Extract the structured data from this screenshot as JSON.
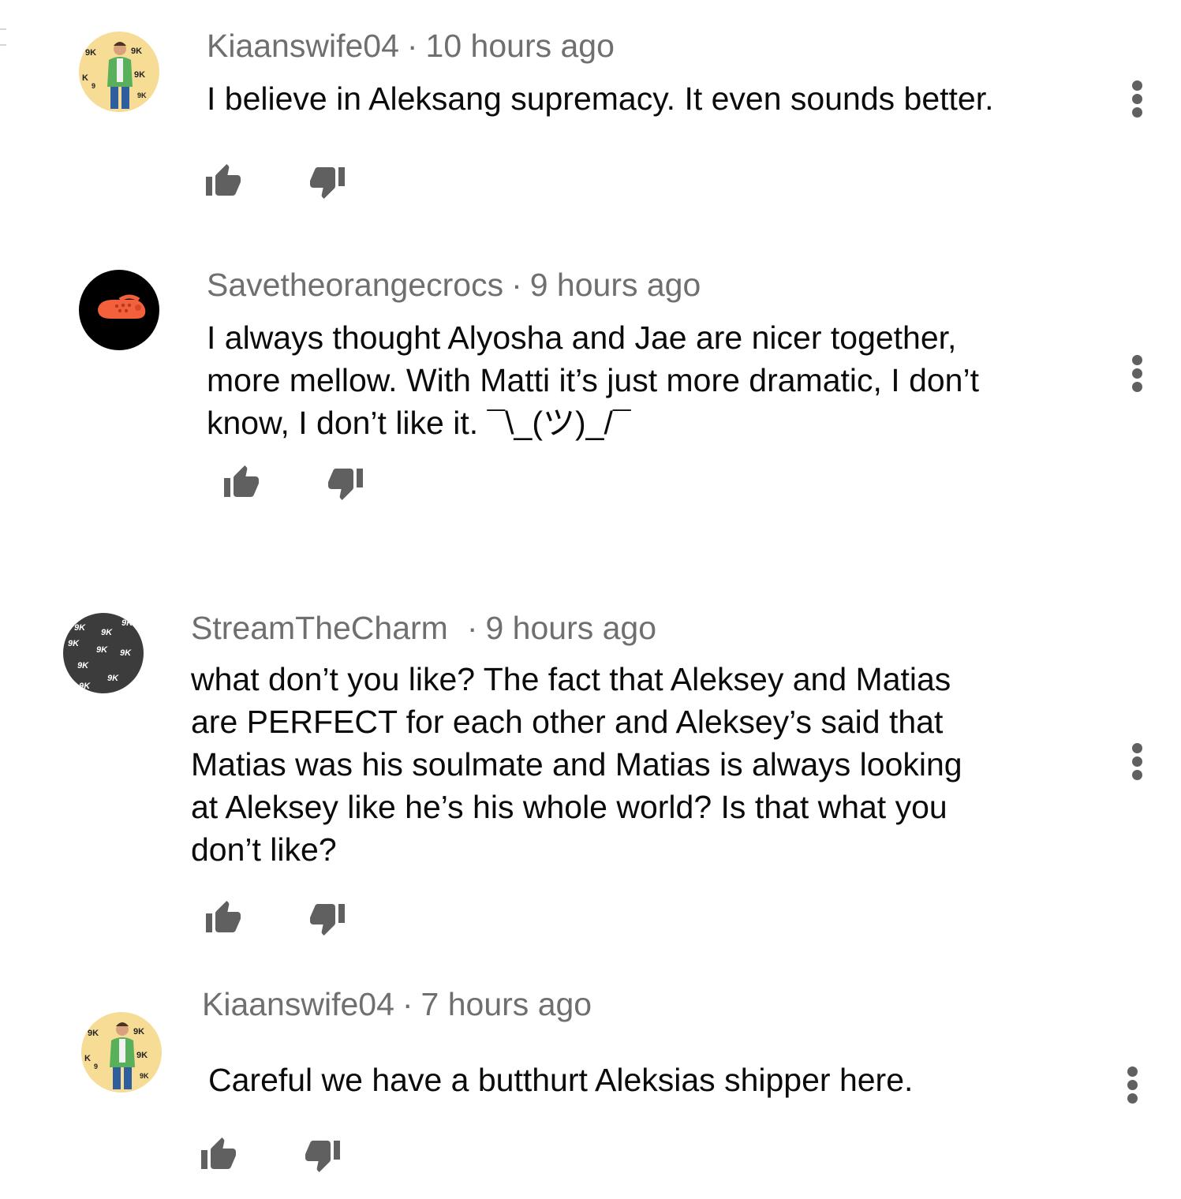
{
  "colors": {
    "meta_text": "#6f6f6f",
    "body_text": "#0b0b0b",
    "icon": "#606060",
    "avatar_yellow": "#f6dc95",
    "avatar_dark": "#3c3c3c",
    "avatar_black": "#000000",
    "croc_orange": "#f2613b"
  },
  "comments": [
    {
      "author": "Kiaanswife04",
      "separator": "·",
      "time": "10 hours ago",
      "text": "I believe in Aleksang supremacy. It even sounds better.",
      "avatar_icon": "person-9k-pattern-avatar",
      "like_icon": "thumbs-up-icon",
      "dislike_icon": "thumbs-down-icon",
      "more_icon": "vertical-dots-icon"
    },
    {
      "author": "Savetheorangecrocs",
      "separator": "·",
      "time": "9 hours ago",
      "text": "I always thought Alyosha and Jae are nicer together,\nmore mellow. With Matti it’s just more dramatic, I don’t\nknow, I don’t like it. ¯\\_(ツ)_/¯",
      "avatar_icon": "orange-croc-avatar",
      "like_icon": "thumbs-up-icon",
      "dislike_icon": "thumbs-down-icon",
      "more_icon": "vertical-dots-icon"
    },
    {
      "author": "StreamTheCharm",
      "separator": "·",
      "time": "9 hours ago",
      "text": "what don’t you like? The fact that Aleksey and Matias\nare PERFECT for each other and Aleksey’s said that\nMatias was his soulmate and Matias is always looking\nat Aleksey like he’s his whole world? Is that what you\ndon’t like?",
      "avatar_icon": "9k-pattern-avatar",
      "like_icon": "thumbs-up-icon",
      "dislike_icon": "thumbs-down-icon",
      "more_icon": "vertical-dots-icon"
    },
    {
      "author": "Kiaanswife04",
      "separator": "·",
      "time": "7 hours ago",
      "text": "Careful we have a butthurt Aleksias shipper here.",
      "avatar_icon": "person-9k-pattern-avatar",
      "like_icon": "thumbs-up-icon",
      "dislike_icon": "thumbs-down-icon",
      "more_icon": "vertical-dots-icon"
    }
  ]
}
